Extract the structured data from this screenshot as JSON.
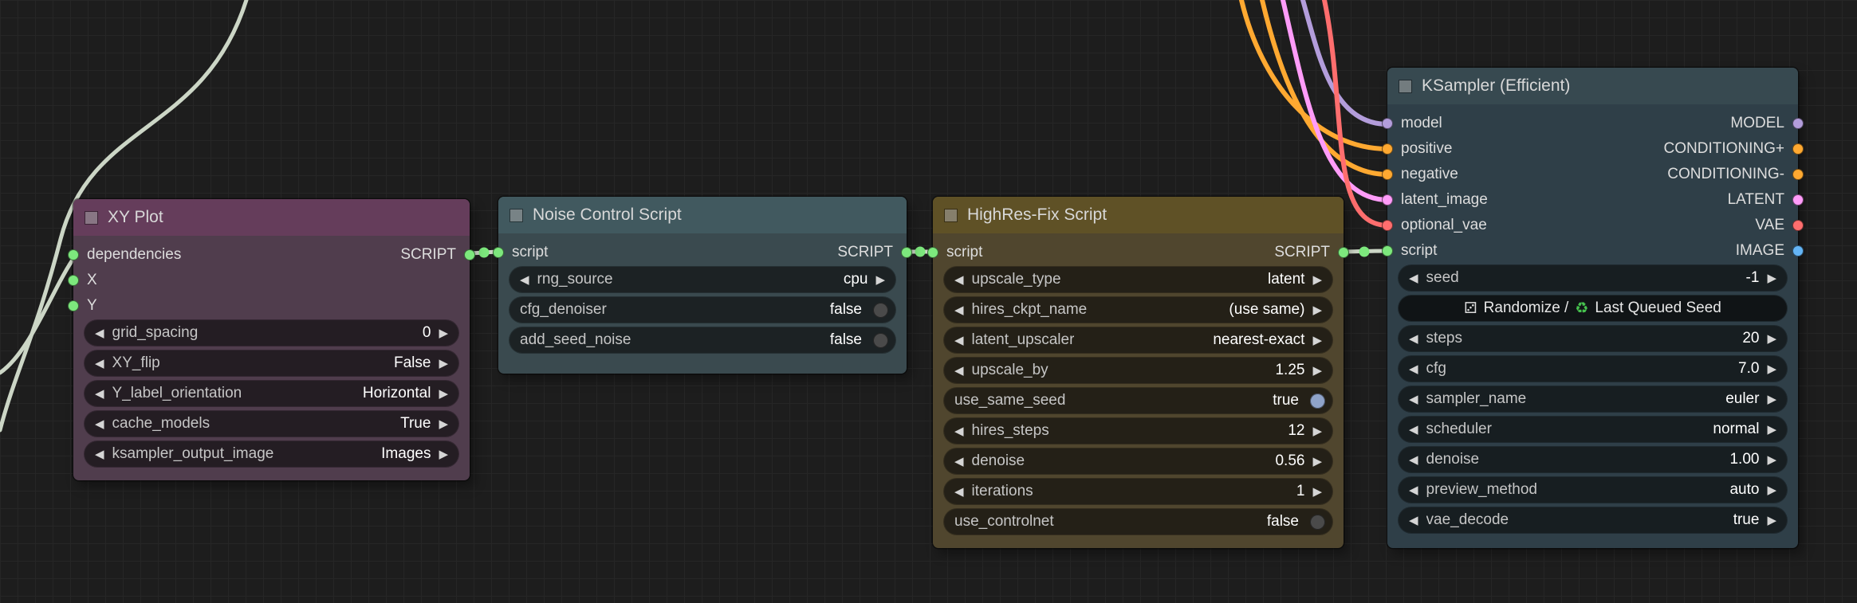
{
  "canvas": {
    "bg": "#1d1d1d",
    "grid_line": "#262626"
  },
  "colors": {
    "script_slot": "#7de87d",
    "model": "#b39ddb",
    "conditioning": "#ffa931",
    "latent": "#ff9cf9",
    "vae": "#ff6e6e",
    "image": "#64b5f6",
    "wire_script": "#ccd6c6",
    "toggle_on": "#8fa3c9",
    "toggle_off": "#4a4a4a"
  },
  "icons": {
    "arrow_left": "◀",
    "arrow_right": "▶"
  },
  "nodes": {
    "xy_plot": {
      "title": "XY Plot",
      "header_bg": "#653d5b",
      "body_bg": "#503d4d",
      "inputs": [
        {
          "label": "dependencies"
        },
        {
          "label": "X"
        },
        {
          "label": "Y"
        }
      ],
      "output": {
        "label": "SCRIPT"
      },
      "widgets": [
        {
          "label": "grid_spacing",
          "value": "0"
        },
        {
          "label": "XY_flip",
          "value": "False"
        },
        {
          "label": "Y_label_orientation",
          "value": "Horizontal"
        },
        {
          "label": "cache_models",
          "value": "True"
        },
        {
          "label": "ksampler_output_image",
          "value": "Images"
        }
      ]
    },
    "noise_control": {
      "title": "Noise Control Script",
      "header_bg": "#41595f",
      "body_bg": "#3a4a4f",
      "input": {
        "label": "script"
      },
      "output": {
        "label": "SCRIPT"
      },
      "widgets": [
        {
          "label": "rng_source",
          "value": "cpu"
        },
        {
          "label": "cfg_denoiser",
          "value": "false"
        },
        {
          "label": "add_seed_noise",
          "value": "false"
        }
      ]
    },
    "highres_fix": {
      "title": "HighRes-Fix Script",
      "header_bg": "#5f5126",
      "body_bg": "#50462e",
      "input": {
        "label": "script"
      },
      "output": {
        "label": "SCRIPT"
      },
      "widgets": [
        {
          "label": "upscale_type",
          "value": "latent"
        },
        {
          "label": "hires_ckpt_name",
          "value": "(use same)"
        },
        {
          "label": "latent_upscaler",
          "value": "nearest-exact"
        },
        {
          "label": "upscale_by",
          "value": "1.25"
        },
        {
          "label": "use_same_seed",
          "value": "true"
        },
        {
          "label": "hires_steps",
          "value": "12"
        },
        {
          "label": "denoise",
          "value": "0.56"
        },
        {
          "label": "iterations",
          "value": "1"
        },
        {
          "label": "use_controlnet",
          "value": "false"
        }
      ]
    },
    "ksampler": {
      "title": "KSampler (Efficient)",
      "header_bg": "#374950",
      "body_bg": "#2f3f48",
      "inputs": [
        {
          "label": "model"
        },
        {
          "label": "positive"
        },
        {
          "label": "negative"
        },
        {
          "label": "latent_image"
        },
        {
          "label": "optional_vae"
        },
        {
          "label": "script"
        }
      ],
      "outputs": [
        {
          "label": "MODEL"
        },
        {
          "label": "CONDITIONING+"
        },
        {
          "label": "CONDITIONING-"
        },
        {
          "label": "LATENT"
        },
        {
          "label": "VAE"
        },
        {
          "label": "IMAGE"
        }
      ],
      "seed_widget": {
        "label": "seed",
        "value": "-1"
      },
      "seed_button": {
        "dice_glyph": "⚂",
        "text_1": "Randomize /",
        "recycle_glyph": "♻",
        "text_2": "Last Queued Seed"
      },
      "widgets": [
        {
          "label": "steps",
          "value": "20"
        },
        {
          "label": "cfg",
          "value": "7.0"
        },
        {
          "label": "sampler_name",
          "value": "euler"
        },
        {
          "label": "scheduler",
          "value": "normal"
        },
        {
          "label": "denoise",
          "value": "1.00"
        },
        {
          "label": "preview_method",
          "value": "auto"
        },
        {
          "label": "vae_decode",
          "value": "true"
        }
      ]
    }
  }
}
